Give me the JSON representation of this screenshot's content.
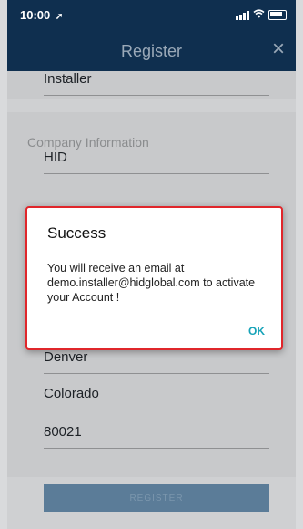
{
  "status": {
    "time": "10:00"
  },
  "header": {
    "title": "Register",
    "close_label": "×"
  },
  "form": {
    "installer_field": "Installer",
    "section_company": "Company Information",
    "company_field": "HID",
    "city_field": "Denver",
    "state_field": "Colorado",
    "zip_field": "80021",
    "register_label": "REGISTER"
  },
  "dialog": {
    "title": "Success",
    "message": "You will receive an email at demo.installer@hidglobal.com to activate your Account !",
    "ok_label": "OK"
  },
  "colors": {
    "header": "#0f2f4f",
    "accent": "#16a3b8",
    "dialog_border": "#e0262b"
  },
  "icons": [
    "location-arrow-icon",
    "signal-icon",
    "wifi-icon",
    "battery-icon",
    "close-icon"
  ]
}
